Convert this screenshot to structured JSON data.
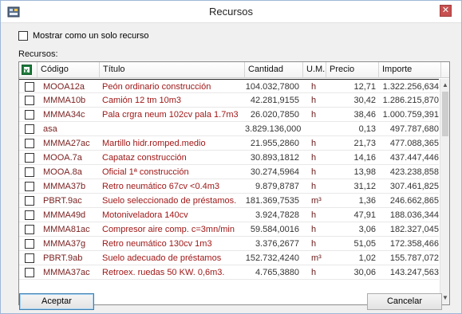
{
  "window": {
    "title": "Recursos",
    "close_glyph": "✕"
  },
  "options": {
    "single_resource_label": "Mostrar como un solo recurso",
    "single_resource_checked": false
  },
  "section_label": "Recursos:",
  "table": {
    "columns": {
      "code": "Código",
      "title": "Título",
      "qty": "Cantidad",
      "um": "U.M.",
      "price": "Precio",
      "amount": "Importe"
    },
    "rows": [
      {
        "code": "MOOA12a",
        "title": "Peón ordinario construcción",
        "qty": "104.032,7800",
        "um": "h",
        "price": "12,71",
        "amount": "1.322.256,634"
      },
      {
        "code": "MMMA10b",
        "title": "Camión 12 tm  10m3",
        "qty": "42.281,9155",
        "um": "h",
        "price": "30,42",
        "amount": "1.286.215,870"
      },
      {
        "code": "MMMA34c",
        "title": "Pala crgra neum 102cv pala 1.7m3",
        "qty": "26.020,7850",
        "um": "h",
        "price": "38,46",
        "amount": "1.000.759,391"
      },
      {
        "code": "asa",
        "title": "",
        "qty": "3.829.136,0000",
        "um": "",
        "price": "0,13",
        "amount": "497.787,680"
      },
      {
        "code": "MMMA27ac",
        "title": "Martillo hidr.romped.medio",
        "qty": "21.955,2860",
        "um": "h",
        "price": "21,73",
        "amount": "477.088,365"
      },
      {
        "code": "MOOA.7a",
        "title": "Capataz construcción",
        "qty": "30.893,1812",
        "um": "h",
        "price": "14,16",
        "amount": "437.447,446"
      },
      {
        "code": "MOOA.8a",
        "title": "Oficial 1ª construcción",
        "qty": "30.274,5964",
        "um": "h",
        "price": "13,98",
        "amount": "423.238,858"
      },
      {
        "code": "MMMA37b",
        "title": "Retro neumático 67cv <0.4m3",
        "qty": "9.879,8787",
        "um": "h",
        "price": "31,12",
        "amount": "307.461,825"
      },
      {
        "code": "PBRT.9ac",
        "title": "Suelo seleccionado de préstamos.",
        "qty": "181.369,7535",
        "um": "m³",
        "price": "1,36",
        "amount": "246.662,865"
      },
      {
        "code": "MMMA49d",
        "title": "Motoniveladora 140cv",
        "qty": "3.924,7828",
        "um": "h",
        "price": "47,91",
        "amount": "188.036,344"
      },
      {
        "code": "MMMA81ac",
        "title": "Compresor aire comp. c=3mn/min",
        "qty": "59.584,0016",
        "um": "h",
        "price": "3,06",
        "amount": "182.327,045"
      },
      {
        "code": "MMMA37g",
        "title": "Retro neumático 130cv 1m3",
        "qty": "3.376,2677",
        "um": "h",
        "price": "51,05",
        "amount": "172.358,466"
      },
      {
        "code": "PBRT.9ab",
        "title": "Suelo adecuado de préstamos",
        "qty": "152.732,4240",
        "um": "m³",
        "price": "1,02",
        "amount": "155.787,072"
      },
      {
        "code": "MMMA37ac",
        "title": "Retroex. ruedas 50 KW. 0,6m3.",
        "qty": "4.765,3880",
        "um": "h",
        "price": "30,06",
        "amount": "143.247,563"
      }
    ]
  },
  "scrollbar": {
    "up_glyph": "▲",
    "down_glyph": "▼"
  },
  "buttons": {
    "ok_label": "Aceptar",
    "cancel_label": "Cancelar"
  },
  "colors": {
    "code_text": "#7a1f1f",
    "title_text": "#a01818",
    "excel_green": "#1e7a3c"
  }
}
